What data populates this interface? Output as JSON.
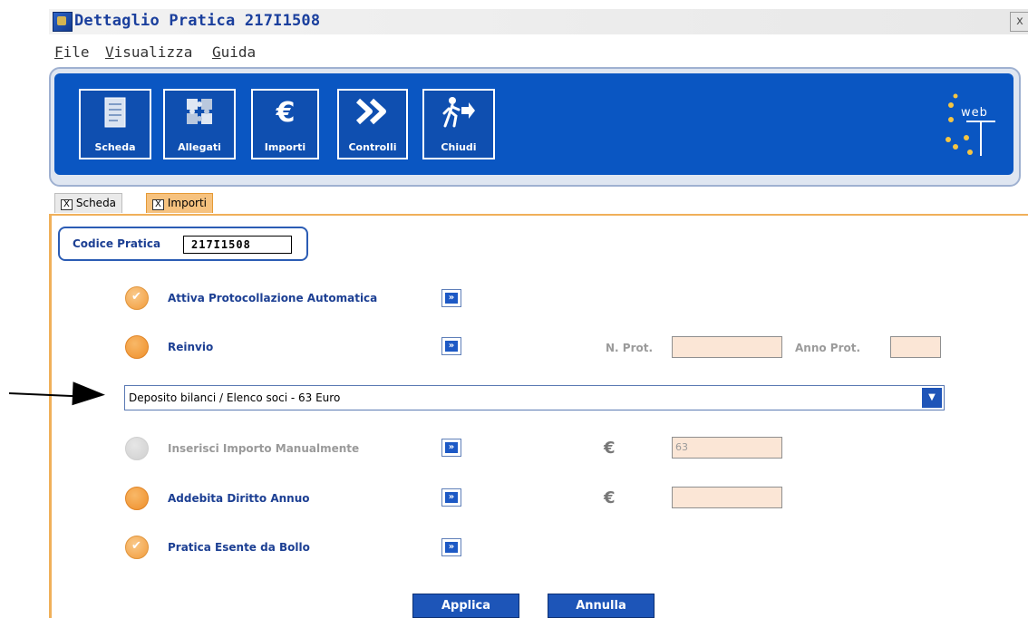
{
  "window": {
    "title": "Dettaglio Pratica 217I1508",
    "close_label": "x"
  },
  "menu": [
    {
      "label": "File",
      "access": "F",
      "rest": "ile"
    },
    {
      "label": "Visualizza",
      "access": "V",
      "rest": "isualizza"
    },
    {
      "label": "Guida",
      "access": "G",
      "rest": "uida"
    }
  ],
  "toolbar": {
    "buttons": [
      {
        "label": "Scheda",
        "icon": "document-icon"
      },
      {
        "label": "Allegati",
        "icon": "puzzle-icon"
      },
      {
        "label": "Importi",
        "icon": "euro-icon"
      },
      {
        "label": "Controlli",
        "icon": "double-arrow-icon"
      },
      {
        "label": "Chiudi",
        "icon": "exit-icon"
      }
    ],
    "logo_text": "web"
  },
  "tabs": [
    {
      "label": "Scheda",
      "close": "X",
      "active": false
    },
    {
      "label": "Importi",
      "close": "X",
      "active": true
    }
  ],
  "codice": {
    "label": "Codice Pratica",
    "value": "217I1508"
  },
  "options": [
    {
      "label": "Attiva Protocollazione Automatica",
      "state": "checked",
      "enabled": true
    },
    {
      "label": "Reinvio",
      "state": "on",
      "enabled": true
    },
    {
      "label": "Inserisci Importo Manualmente",
      "state": "off",
      "enabled": false
    },
    {
      "label": "Addebita Diritto Annuo",
      "state": "on",
      "enabled": true
    },
    {
      "label": "Pratica Esente da Bollo",
      "state": "checked",
      "enabled": true
    }
  ],
  "go_glyph": "»",
  "reinvio_fields": {
    "nprot_label": "N. Prot.",
    "nprot_value": "",
    "anno_label": "Anno Prot.",
    "anno_value": ""
  },
  "tariff_select": {
    "value": "Deposito bilanci / Elenco soci - 63 Euro"
  },
  "importo_manual": {
    "currency": "€",
    "value": "63"
  },
  "diritto_annuo": {
    "currency": "€",
    "value": ""
  },
  "actions": {
    "apply_label": "Applica",
    "cancel_label": "Annulla"
  },
  "colors": {
    "toolbar_blue": "#0a56c2",
    "accent_orange": "#f0b05a",
    "label_blue": "#1c3f93"
  }
}
